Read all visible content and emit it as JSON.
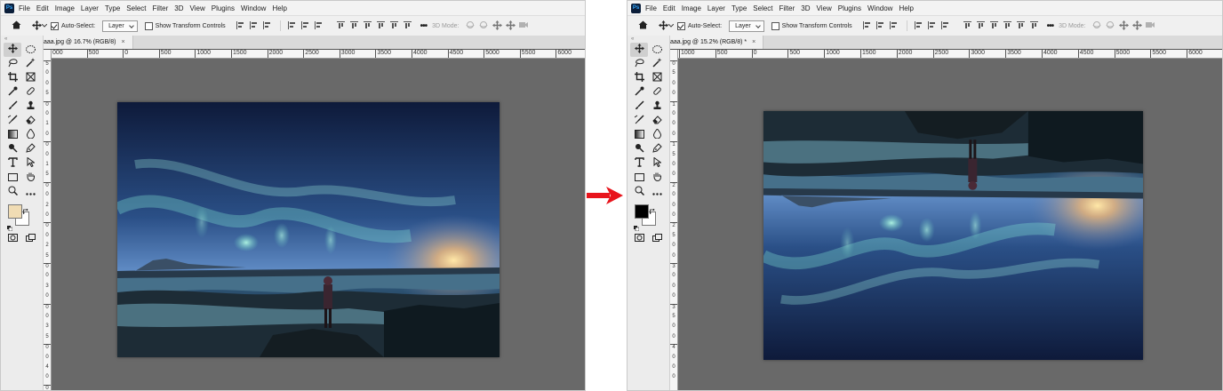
{
  "panels": {
    "left": {
      "menu": [
        "File",
        "Edit",
        "Image",
        "Layer",
        "Type",
        "Select",
        "Filter",
        "3D",
        "View",
        "Plugins",
        "Window",
        "Help"
      ],
      "options": {
        "auto_select_label": "Auto-Select:",
        "layer_select": "Layer",
        "transform_label": "Show Transform Controls",
        "mode3d_label": "3D Mode:"
      },
      "tab": {
        "title": "aaa.jpg @ 16.7% (RGB/8)",
        "close": "×"
      },
      "ruler_top": [
        "000",
        "500",
        "0",
        "500",
        "1000",
        "1500",
        "2000",
        "2500",
        "3000",
        "3500",
        "4000",
        "4500",
        "5000",
        "5500",
        "6000"
      ],
      "ruler_left": [
        "5",
        "0",
        "0",
        "5",
        "0",
        "0",
        "1",
        "0",
        "0",
        "0",
        "1",
        "5",
        "0",
        "0",
        "2",
        "0",
        "0",
        "0",
        "2",
        "5",
        "0",
        "0",
        "3",
        "0",
        "0",
        "0",
        "3",
        "5",
        "0",
        "0",
        "4",
        "0",
        "0"
      ],
      "fg_color": "#f0dcb4",
      "bg_color": "#ffffff",
      "image": {
        "orientation": "upright"
      }
    },
    "right": {
      "menu": [
        "File",
        "Edit",
        "Image",
        "Layer",
        "Type",
        "Select",
        "Filter",
        "3D",
        "View",
        "Plugins",
        "Window",
        "Help"
      ],
      "options": {
        "auto_select_label": "Auto-Select:",
        "layer_select": "Layer",
        "transform_label": "Show Transform Controls",
        "mode3d_label": "3D Mode:"
      },
      "tab": {
        "title": "aaa.jpg @ 15.2% (RGB/8) *",
        "close": "×"
      },
      "ruler_top": [
        "1000",
        "500",
        "0",
        "500",
        "1000",
        "1500",
        "2000",
        "2500",
        "3000",
        "3500",
        "4000",
        "4500",
        "5000",
        "5500",
        "6000"
      ],
      "ruler_left": [
        "0",
        "5",
        "0",
        "0",
        "1",
        "0",
        "0",
        "0",
        "1",
        "5",
        "0",
        "0",
        "2",
        "0",
        "0",
        "0",
        "2",
        "5",
        "0",
        "0",
        "3",
        "0",
        "0",
        "0",
        "3",
        "5",
        "0",
        "0",
        "4",
        "0",
        "0",
        "0"
      ],
      "fg_color": "#000000",
      "bg_color": "#ffffff",
      "image": {
        "orientation": "flipped-vertical"
      }
    }
  },
  "arrow_color": "#e8141c"
}
